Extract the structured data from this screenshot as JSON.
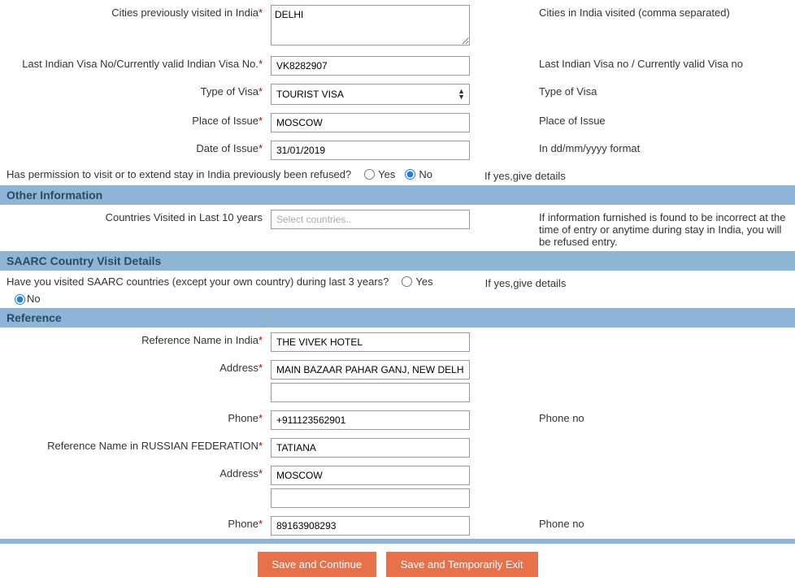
{
  "fields": {
    "cities_visited": {
      "label": "Cities previously visited in India",
      "value": "DELHI",
      "hint": "Cities in India visited (comma separated)"
    },
    "last_visa_no": {
      "label": "Last Indian Visa No/Currently valid Indian Visa No.",
      "value": "VK8282907",
      "hint": "Last Indian Visa no / Currently valid Visa no"
    },
    "visa_type": {
      "label": "Type of Visa",
      "value": "TOURIST VISA",
      "hint": "Type of Visa"
    },
    "place_of_issue": {
      "label": "Place of Issue",
      "value": "MOSCOW",
      "hint": "Place of Issue"
    },
    "date_of_issue": {
      "label": "Date of Issue",
      "value": "31/01/2019",
      "hint": "In dd/mm/yyyy format"
    },
    "permission_refused": {
      "question": "Has permission to visit or to extend stay in India previously been refused?",
      "hint": "If yes,give details"
    },
    "countries_visited": {
      "label": "Countries Visited in Last 10 years",
      "placeholder": "Select countries..",
      "hint": "If information furnished is found to be incorrect at the time of entry or anytime during stay in India, you will be refused entry."
    },
    "saarc_visited": {
      "question": "Have you visited SAARC countries (except your own country) during last 3 years?",
      "hint": "If yes,give details"
    },
    "ref_india_name": {
      "label": "Reference Name in India",
      "value": "THE VIVEK HOTEL"
    },
    "ref_india_addr": {
      "label": "Address",
      "value1": "MAIN BAZAAR PAHAR GANJ, NEW DELHI",
      "value2": ""
    },
    "ref_india_phone": {
      "label": "Phone",
      "value": "+911123562901",
      "hint": "Phone no"
    },
    "ref_home_name": {
      "label": "Reference Name in RUSSIAN FEDERATION",
      "value": "TATIANA"
    },
    "ref_home_addr": {
      "label": "Address",
      "value1": "MOSCOW",
      "value2": ""
    },
    "ref_home_phone": {
      "label": "Phone",
      "value": "89163908293",
      "hint": "Phone no"
    }
  },
  "sections": {
    "other_info": "Other Information",
    "saarc": "SAARC Country Visit Details",
    "reference": "Reference"
  },
  "radio": {
    "yes": "Yes",
    "no": "No"
  },
  "buttons": {
    "save_continue": "Save and Continue",
    "save_exit": "Save and Temporarily Exit"
  },
  "required_mark": "*"
}
